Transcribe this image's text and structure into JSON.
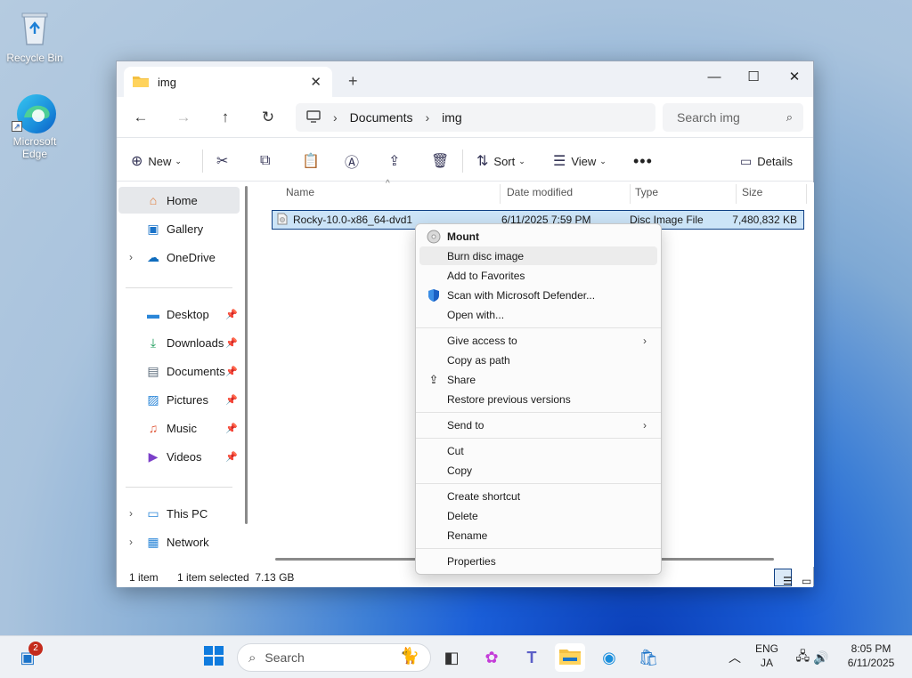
{
  "desktop": {
    "icons": [
      {
        "label": "Recycle Bin",
        "icon": "recycle-bin-icon"
      },
      {
        "label": "Microsoft Edge",
        "icon": "edge-icon"
      }
    ]
  },
  "window": {
    "tab_title": "img",
    "breadcrumb": [
      "Documents",
      "img"
    ],
    "search_placeholder": "Search img",
    "toolbar": {
      "new_label": "New",
      "sort_label": "Sort",
      "view_label": "View",
      "details_label": "Details"
    },
    "sidebar": {
      "items": [
        {
          "label": "Home",
          "icon": "home-icon"
        },
        {
          "label": "Gallery",
          "icon": "gallery-icon"
        },
        {
          "label": "OneDrive",
          "icon": "cloud-icon"
        },
        {
          "label": "Desktop",
          "icon": "desktop-icon"
        },
        {
          "label": "Downloads",
          "icon": "download-icon"
        },
        {
          "label": "Documents",
          "icon": "document-icon"
        },
        {
          "label": "Pictures",
          "icon": "pictures-icon"
        },
        {
          "label": "Music",
          "icon": "music-icon"
        },
        {
          "label": "Videos",
          "icon": "videos-icon"
        },
        {
          "label": "This PC",
          "icon": "pc-icon"
        },
        {
          "label": "Network",
          "icon": "network-icon"
        }
      ]
    },
    "columns": [
      "Name",
      "Date modified",
      "Type",
      "Size"
    ],
    "files": [
      {
        "name": "Rocky-10.0-x86_64-dvd1",
        "date": "6/11/2025 7:59 PM",
        "type": "Disc Image File",
        "size": "7,480,832 KB"
      }
    ],
    "status": {
      "item_count": "1 item",
      "selection": "1 item selected  7.13 GB"
    }
  },
  "context_menu": {
    "items": [
      {
        "label": "Mount",
        "icon": "disc-icon",
        "bold": true
      },
      {
        "label": "Burn disc image",
        "highlighted": true
      },
      {
        "label": "Add to Favorites"
      },
      {
        "label": "Scan with Microsoft Defender...",
        "icon": "shield-icon"
      },
      {
        "label": "Open with..."
      },
      {
        "label": "Give access to",
        "submenu": true
      },
      {
        "label": "Copy as path"
      },
      {
        "label": "Share",
        "icon": "share-icon"
      },
      {
        "label": "Restore previous versions"
      },
      {
        "label": "Send to",
        "submenu": true
      },
      {
        "label": "Cut"
      },
      {
        "label": "Copy"
      },
      {
        "label": "Create shortcut"
      },
      {
        "label": "Delete"
      },
      {
        "label": "Rename"
      },
      {
        "label": "Properties"
      }
    ]
  },
  "taskbar": {
    "badge_count": "2",
    "search_placeholder": "Search",
    "lang": "ENG",
    "ime": "JA",
    "time": "8:05 PM",
    "date": "6/11/2025"
  },
  "colors": {
    "accent": "#0e3f84",
    "selection": "#cce4f7"
  }
}
